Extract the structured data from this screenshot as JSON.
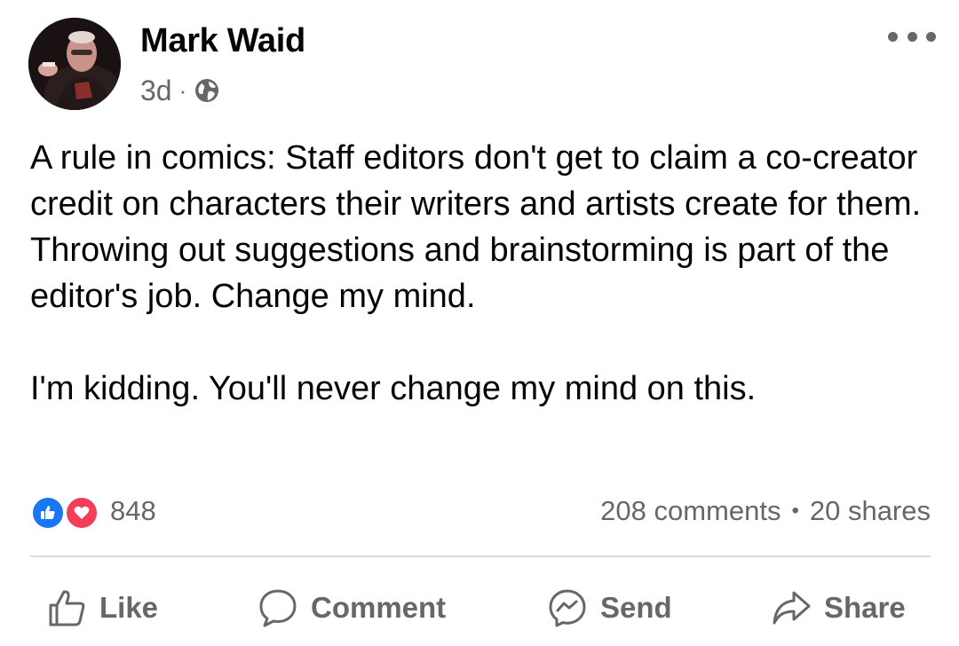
{
  "author": {
    "name": "Mark Waid",
    "time": "3d",
    "separator": "·",
    "audience_icon": "globe-icon"
  },
  "post": {
    "paragraphs": [
      "A rule in comics: Staff editors don't get to claim a co-creator credit on characters their writers and artists create for them. Throwing out suggestions and brainstorming is part of the editor's job. Change my mind.",
      "I'm kidding. You'll never change my mind on this."
    ]
  },
  "engagement": {
    "reactions": [
      "like-reaction-icon",
      "love-reaction-icon"
    ],
    "reaction_count": "848",
    "comments": "208 comments",
    "separator": "•",
    "shares": "20 shares"
  },
  "actions": {
    "like": "Like",
    "comment": "Comment",
    "send": "Send",
    "share": "Share"
  },
  "colors": {
    "like_blue": "#1877f2",
    "love_red": "#f33e58",
    "secondary_text": "#65676b"
  }
}
